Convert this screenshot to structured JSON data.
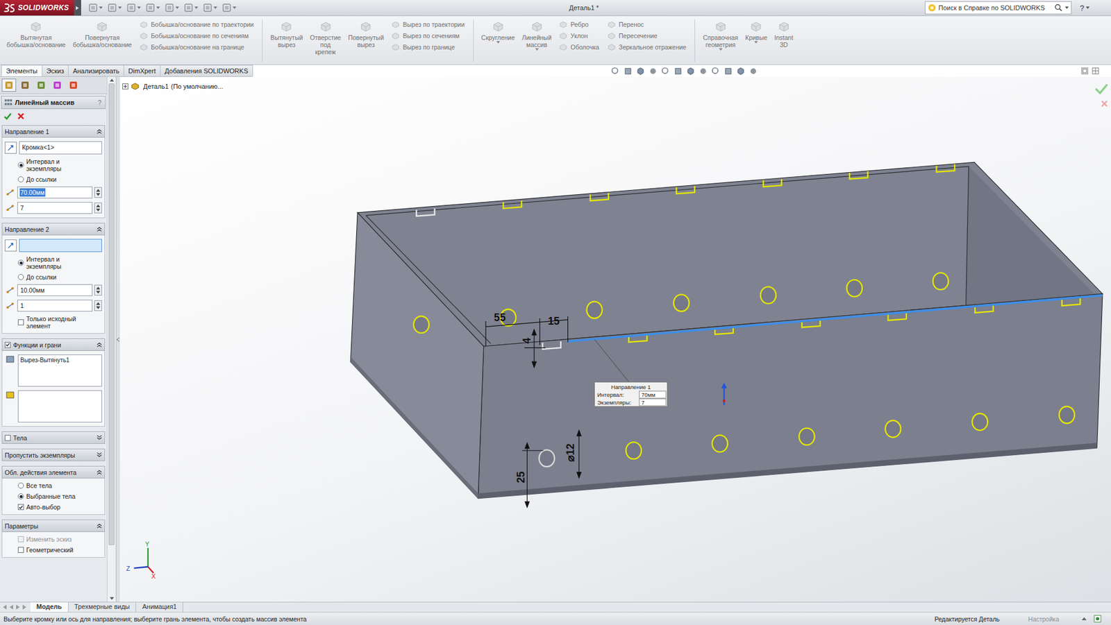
{
  "window": {
    "app": "SOLIDWORKS",
    "title": "Деталь1 *",
    "help": "?"
  },
  "search": {
    "placeholder": "Поиск в Справке по SOLIDWORKS"
  },
  "ribbon": [
    {
      "kind": "large",
      "lines": [
        "Вытянутая",
        "бобышка/основание"
      ],
      "menu": false,
      "disabled": true
    },
    {
      "kind": "large",
      "lines": [
        "Повернутая",
        "бобышка/основание"
      ],
      "menu": false,
      "disabled": true
    },
    {
      "kind": "stack",
      "items": [
        {
          "label": "Бобышка/основание по траектории",
          "disabled": true
        },
        {
          "label": "Бобышка/основание по сечениям",
          "disabled": true
        },
        {
          "label": "Бобышка/основание на границе",
          "disabled": true
        }
      ]
    },
    {
      "kind": "separator"
    },
    {
      "kind": "large",
      "lines": [
        "Вытянутый",
        "вырез"
      ],
      "menu": false,
      "disabled": true
    },
    {
      "kind": "large",
      "lines": [
        "Отверстие",
        "под",
        "крепеж"
      ],
      "menu": false,
      "disabled": true
    },
    {
      "kind": "large",
      "lines": [
        "Повернутый",
        "вырез"
      ],
      "menu": false,
      "disabled": true
    },
    {
      "kind": "stack",
      "items": [
        {
          "label": "Вырез по траектории",
          "disabled": true
        },
        {
          "label": "Вырез по сечениям",
          "disabled": true
        },
        {
          "label": "Вырез по границе",
          "disabled": true
        }
      ]
    },
    {
      "kind": "separator"
    },
    {
      "kind": "large",
      "lines": [
        "Скругление"
      ],
      "menu": true,
      "disabled": true
    },
    {
      "kind": "large",
      "lines": [
        "Линейный",
        "массив"
      ],
      "menu": true,
      "disabled": true
    },
    {
      "kind": "stack",
      "items": [
        {
          "label": "Ребро",
          "disabled": true
        },
        {
          "label": "Уклон",
          "disabled": true
        },
        {
          "label": "Оболочка",
          "disabled": true
        }
      ]
    },
    {
      "kind": "stack",
      "items": [
        {
          "label": "Перенос",
          "disabled": true
        },
        {
          "label": "Пересечение",
          "disabled": true
        },
        {
          "label": "Зеркальное отражение",
          "disabled": true
        }
      ]
    },
    {
      "kind": "separator"
    },
    {
      "kind": "large",
      "lines": [
        "Справочная",
        "геометрия"
      ],
      "menu": true,
      "disabled": true
    },
    {
      "kind": "large",
      "lines": [
        "Кривые"
      ],
      "menu": true,
      "disabled": true
    },
    {
      "kind": "large",
      "lines": [
        "Instant",
        "3D"
      ],
      "menu": false,
      "disabled": true
    }
  ],
  "tabs": [
    {
      "label": "Элементы",
      "selected": true
    },
    {
      "label": "Эскиз",
      "selected": false
    },
    {
      "label": "Анализировать",
      "selected": false
    },
    {
      "label": "DimXpert",
      "selected": false
    },
    {
      "label": "Добавления SOLIDWORKS",
      "selected": false
    }
  ],
  "property_manager": {
    "title": "Линейный массив",
    "help": "?",
    "sections": [
      {
        "title": "Направление 1",
        "expanded": true,
        "has_checkbox": false,
        "rows": [
          {
            "kind": "selection",
            "value": "Кромка<1>",
            "active": false
          },
          {
            "kind": "radio",
            "label": "Интервал и экземпляры",
            "selected": true
          },
          {
            "kind": "radio",
            "label": "До ссылки",
            "selected": false
          },
          {
            "kind": "spin",
            "value": "70.00мм",
            "highlighted": true
          },
          {
            "kind": "spin",
            "value": "7",
            "highlighted": false
          }
        ]
      },
      {
        "title": "Направление 2",
        "expanded": true,
        "has_checkbox": false,
        "rows": [
          {
            "kind": "selection",
            "value": "",
            "active": true
          },
          {
            "kind": "radio",
            "label": "Интервал и экземпляры",
            "selected": true
          },
          {
            "kind": "radio",
            "label": "До ссылки",
            "selected": false
          },
          {
            "kind": "spin",
            "value": "10.00мм",
            "highlighted": false
          },
          {
            "kind": "spin",
            "value": "1",
            "highlighted": false
          },
          {
            "kind": "checkbox",
            "label": "Только исходный элемент",
            "checked": false,
            "disabled": false
          }
        ]
      },
      {
        "title": "Функции и грани",
        "expanded": true,
        "has_checkbox": true,
        "checked": true,
        "rows": [
          {
            "kind": "list",
            "items": [
              "Вырез-Вытянуть1"
            ]
          },
          {
            "kind": "list",
            "items": []
          }
        ]
      },
      {
        "title": "Тела",
        "expanded": false,
        "has_checkbox": true,
        "checked": false,
        "rows": []
      },
      {
        "title": "Пропустить экземпляры",
        "expanded": false,
        "has_checkbox": false,
        "rows": []
      },
      {
        "title": "Обл. действия элемента",
        "expanded": true,
        "has_checkbox": false,
        "rows": [
          {
            "kind": "radio",
            "label": "Все тела",
            "selected": false
          },
          {
            "kind": "radio",
            "label": "Выбранные тела",
            "selected": true
          },
          {
            "kind": "checkbox",
            "label": "Авто-выбор",
            "checked": true,
            "disabled": false
          }
        ]
      },
      {
        "title": "Параметры",
        "expanded": true,
        "has_checkbox": false,
        "rows": [
          {
            "kind": "checkbox",
            "label": "Изменить эскиз",
            "checked": false,
            "disabled": true
          },
          {
            "kind": "checkbox",
            "label": "Геометрический",
            "checked": false,
            "disabled": false
          }
        ]
      }
    ]
  },
  "feature_tree": {
    "label": "Деталь1",
    "suffix": "(По умолчанию..."
  },
  "scene": {
    "dimensions": [
      {
        "text": "55"
      },
      {
        "text": "15"
      },
      {
        "text": "4"
      },
      {
        "text": "⌀12"
      },
      {
        "text": "25"
      }
    ],
    "callout": {
      "title": "Направление 1",
      "rows": [
        {
          "label": "Интервал:",
          "value": "70мм"
        },
        {
          "label": "Экземпляры:",
          "value": "7"
        }
      ]
    },
    "axes": [
      {
        "label": "Y",
        "color": "#2a9d2a"
      },
      {
        "label": "Z",
        "color": "#1f3fbf"
      },
      {
        "label": "X",
        "color": "#cc2222"
      }
    ]
  },
  "bottom_tabs": [
    {
      "label": "Модель",
      "selected": true
    },
    {
      "label": "Трехмерные виды",
      "selected": false
    },
    {
      "label": "Анимация1",
      "selected": false
    }
  ],
  "status_bar": {
    "message": "Выберите кромку или ось для направления; выберите грань элемента, чтобы создать массив элемента",
    "mode": "Редактируется Деталь",
    "units": "Настройка",
    "units_disabled": true
  }
}
